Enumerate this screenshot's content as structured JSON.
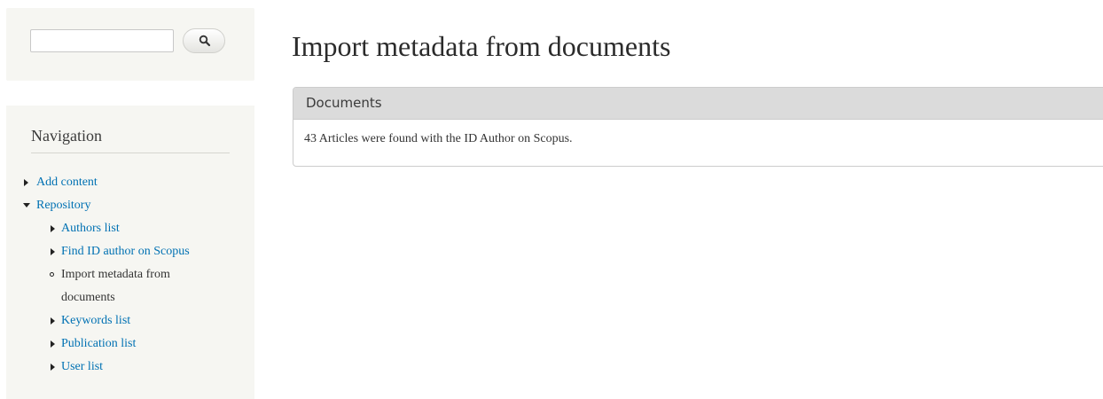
{
  "search": {
    "value": "",
    "button_icon": "search-icon"
  },
  "navigation": {
    "title": "Navigation",
    "items": [
      {
        "label": "Add content",
        "state": "collapsed"
      },
      {
        "label": "Repository",
        "state": "expanded",
        "children": [
          {
            "label": "Authors list",
            "state": "collapsed"
          },
          {
            "label": "Find ID author on Scopus",
            "state": "collapsed"
          },
          {
            "label": "Import metadata from documents",
            "state": "active"
          },
          {
            "label": "Keywords list",
            "state": "collapsed"
          },
          {
            "label": "Publication list",
            "state": "collapsed"
          },
          {
            "label": "User list",
            "state": "collapsed"
          }
        ]
      }
    ]
  },
  "main": {
    "title": "Import metadata from documents",
    "fieldset": {
      "legend": "Documents",
      "message": "43 Articles were found with the ID Author on Scopus."
    }
  },
  "colors": {
    "link": "#0071b3",
    "sidebar_bg": "#f6f6f2",
    "legend_bg": "#dbdbdb"
  }
}
